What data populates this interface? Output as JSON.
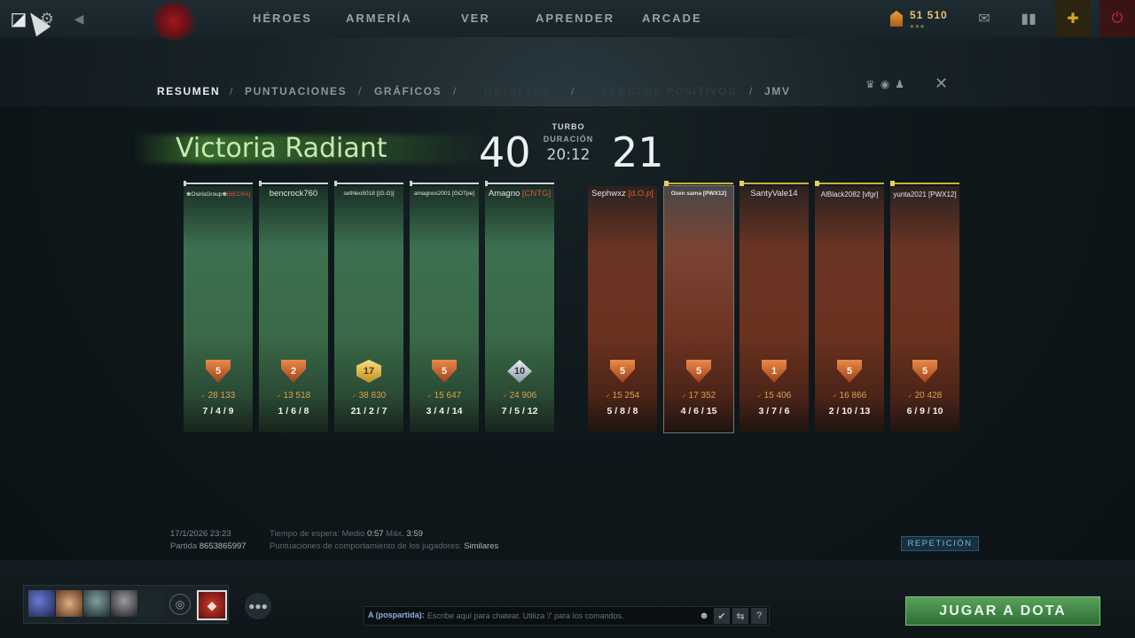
{
  "nav": {
    "items": [
      "HÉROES",
      "ARMERÍA",
      "VER",
      "APRENDER",
      "ARCADE"
    ],
    "shards": "51 510"
  },
  "subnav": {
    "tabs": [
      "RESUMEN",
      "PUNTUACIONES",
      "GRÁFICOS",
      "DETALLES",
      "EFECTOS POSITIVOS",
      "JMV"
    ],
    "active": "RESUMEN"
  },
  "match": {
    "result": "Victoria Radiant",
    "radiant_score": "40",
    "dire_score": "21",
    "mode": "TURBO",
    "duration_label": "DURACIÓN",
    "duration": "20:12"
  },
  "radiant": [
    {
      "name": "♚OsirisGroup♚",
      "tag": "[BECRA]",
      "medal": "5",
      "networth": "28 133",
      "kda": "7 / 4 / 9"
    },
    {
      "name": "bencrock760",
      "tag": "",
      "medal": "2",
      "networth": "13 518",
      "kda": "1 / 6 / 8"
    },
    {
      "name": "sethleo5018",
      "tag": "[(G.G)]",
      "medal": "17",
      "networth": "38 830",
      "kda": "21 / 2 / 7"
    },
    {
      "name": "amagnos2001",
      "tag": "[GOTpe]",
      "medal": "5",
      "networth": "15 647",
      "kda": "3 / 4 / 14"
    },
    {
      "name": "Amagno",
      "tag": "[CNTG]",
      "medal": "10",
      "networth": "24 906",
      "kda": "7 / 5 / 12"
    }
  ],
  "dire": [
    {
      "name": "Sephwxz",
      "tag": "[d.O.p]",
      "medal": "5",
      "networth": "15 254",
      "kda": "5 / 8 / 8"
    },
    {
      "name": "Ozen sama",
      "tag": "[PWX12]",
      "medal": "5",
      "networth": "17 352",
      "kda": "4 / 6 / 15"
    },
    {
      "name": "SantyVale14",
      "tag": "",
      "medal": "1",
      "networth": "15 406",
      "kda": "3 / 7 / 6"
    },
    {
      "name": "AlBlack2082",
      "tag": "[vfgr]",
      "medal": "5",
      "networth": "16 866",
      "kda": "2 / 10 / 13"
    },
    {
      "name": "yunta2021",
      "tag": "[PWX12]",
      "medal": "5",
      "networth": "20 428",
      "kda": "6 / 9 / 10"
    }
  ],
  "footer": {
    "date": "17/1/2026 23:23",
    "match_label": "Partida",
    "match_id": "8653865997",
    "wait_label": "Tiempo de espera: Medio",
    "wait_mid": "0:57",
    "wait_max_label": "Máx.",
    "wait_max": "3:59",
    "behavior_label": "Puntuaciones de comportamiento de los jugadores:",
    "behavior_value": "Similares",
    "replay": "REPETICIÓN"
  },
  "bottom": {
    "chat_channel": "A (pospartida):",
    "chat_placeholder": "Escribe aquí para chatear. Utiliza '/' para los comandos.",
    "play_button": "JUGAR A DOTA"
  }
}
